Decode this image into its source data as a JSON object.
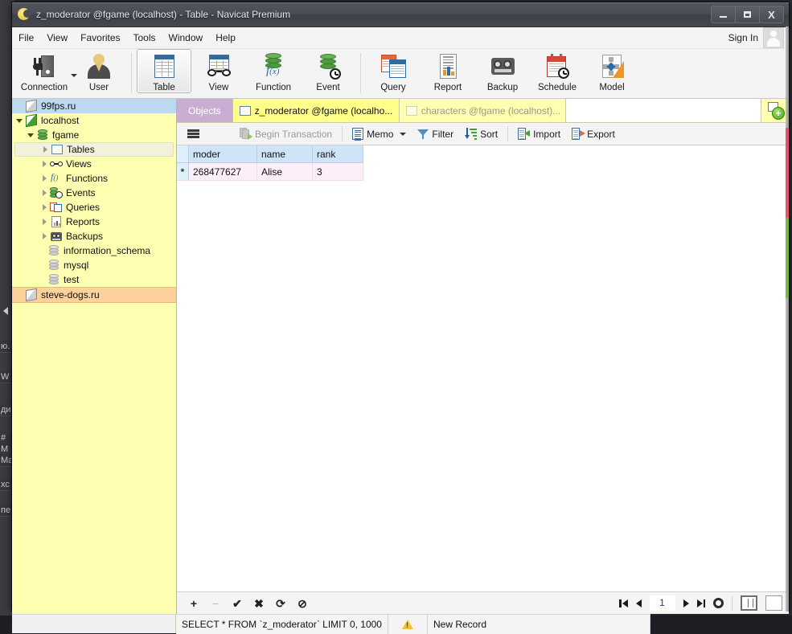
{
  "window": {
    "title": "z_moderator @fgame (localhost) - Table - Navicat Premium",
    "app_icon": "navicat-moon-icon",
    "controls": {
      "minimize": "–",
      "maximize": "□",
      "close": "X"
    }
  },
  "menubar": {
    "items": [
      "File",
      "View",
      "Favorites",
      "Tools",
      "Window",
      "Help"
    ],
    "signin_label": "Sign In"
  },
  "toolbar": {
    "buttons": [
      {
        "label": "Connection",
        "icon": "connection-icon",
        "has_caret": true,
        "active": false
      },
      {
        "label": "User",
        "icon": "user-icon",
        "has_caret": false,
        "active": false
      },
      {
        "label": "Table",
        "icon": "table-icon",
        "has_caret": false,
        "active": true
      },
      {
        "label": "View",
        "icon": "view-icon",
        "has_caret": false,
        "active": false
      },
      {
        "label": "Function",
        "icon": "function-icon",
        "has_caret": false,
        "active": false
      },
      {
        "label": "Event",
        "icon": "event-icon",
        "has_caret": false,
        "active": false
      },
      {
        "label": "Query",
        "icon": "query-icon",
        "has_caret": false,
        "active": false
      },
      {
        "label": "Report",
        "icon": "report-icon",
        "has_caret": false,
        "active": false
      },
      {
        "label": "Backup",
        "icon": "backup-icon",
        "has_caret": false,
        "active": false
      },
      {
        "label": "Schedule",
        "icon": "schedule-icon",
        "has_caret": false,
        "active": false
      },
      {
        "label": "Model",
        "icon": "model-icon",
        "has_caret": false,
        "active": false
      }
    ]
  },
  "sidebar": {
    "items": [
      {
        "label": "99fps.ru",
        "icon": "connection-grey-icon",
        "indent": 0,
        "twisty": "none",
        "state": "selected-blue"
      },
      {
        "label": "localhost",
        "icon": "connection-green-icon",
        "indent": 0,
        "twisty": "open",
        "state": "normal"
      },
      {
        "label": "fgame",
        "icon": "database-green-icon",
        "indent": 1,
        "twisty": "open",
        "state": "normal"
      },
      {
        "label": "Tables",
        "icon": "tables-icon",
        "indent": 2,
        "twisty": "closed",
        "state": "hover"
      },
      {
        "label": "Views",
        "icon": "views-icon",
        "indent": 2,
        "twisty": "closed",
        "state": "normal"
      },
      {
        "label": "Functions",
        "icon": "functions-icon",
        "indent": 2,
        "twisty": "closed",
        "state": "normal"
      },
      {
        "label": "Events",
        "icon": "events-icon",
        "indent": 2,
        "twisty": "closed",
        "state": "normal"
      },
      {
        "label": "Queries",
        "icon": "queries-icon",
        "indent": 2,
        "twisty": "closed",
        "state": "normal"
      },
      {
        "label": "Reports",
        "icon": "reports-icon",
        "indent": 2,
        "twisty": "closed",
        "state": "normal"
      },
      {
        "label": "Backups",
        "icon": "backups-icon",
        "indent": 2,
        "twisty": "closed",
        "state": "normal"
      },
      {
        "label": "information_schema",
        "icon": "database-grey-icon",
        "indent": 1,
        "twisty": "none",
        "state": "normal"
      },
      {
        "label": "mysql",
        "icon": "database-grey-icon",
        "indent": 1,
        "twisty": "none",
        "state": "normal"
      },
      {
        "label": "test",
        "icon": "database-grey-icon",
        "indent": 1,
        "twisty": "none",
        "state": "normal"
      },
      {
        "label": "steve-dogs.ru",
        "icon": "connection-grey-icon",
        "indent": 0,
        "twisty": "none",
        "state": "selected-orange"
      }
    ]
  },
  "tabs": {
    "objects_label": "Objects",
    "items": [
      {
        "label": "z_moderator @fgame (localho...",
        "icon": "table-tab-icon",
        "active": true
      },
      {
        "label": "characters @fgame (localhost)...",
        "icon": "table-tab-icon",
        "active": false
      }
    ],
    "new_tab_icon": "new-table-plus-icon"
  },
  "grid_toolbar": {
    "menu_icon": "hamburger-icon",
    "begin_transaction": "Begin Transaction",
    "memo": "Memo",
    "filter": "Filter",
    "sort": "Sort",
    "import": "Import",
    "export": "Export"
  },
  "table": {
    "columns": [
      "moder",
      "name",
      "rank"
    ],
    "rows": [
      {
        "marker": "*",
        "moder": "268477627",
        "name": "Alise",
        "rank": "3"
      }
    ]
  },
  "grid_nav": {
    "record_buttons": [
      "+",
      "−",
      "✔",
      "✖",
      "⟳",
      "⊘"
    ],
    "page_value": "1",
    "first_icon": "first-page-icon",
    "prev_icon": "prev-page-icon",
    "next_icon": "next-page-icon",
    "last_icon": "last-page-icon",
    "settings_icon": "gear-icon",
    "grid_view_icon": "grid-view-icon",
    "form_view_icon": "form-view-icon"
  },
  "statusbar": {
    "sql": "SELECT * FROM `z_moderator` LIMIT 0, 1000",
    "warning_icon": "warning-icon",
    "state": "New Record"
  },
  "background_window": {
    "visible_fragments": [
      "ю.",
      "W",
      "ди",
      "#",
      "M",
      "Ma",
      "хс",
      "пе"
    ]
  },
  "colors": {
    "sidebar_bg": "#ffffb2",
    "tab_active": "#ffff8c",
    "objects_tab": "#c9aed4",
    "header_blue": "#cfe5f7",
    "row_pink": "#fdeef7",
    "selected_blue": "#bdd9f2",
    "selected_orange": "#fcd29a",
    "titlebar": "#4a4c55"
  }
}
